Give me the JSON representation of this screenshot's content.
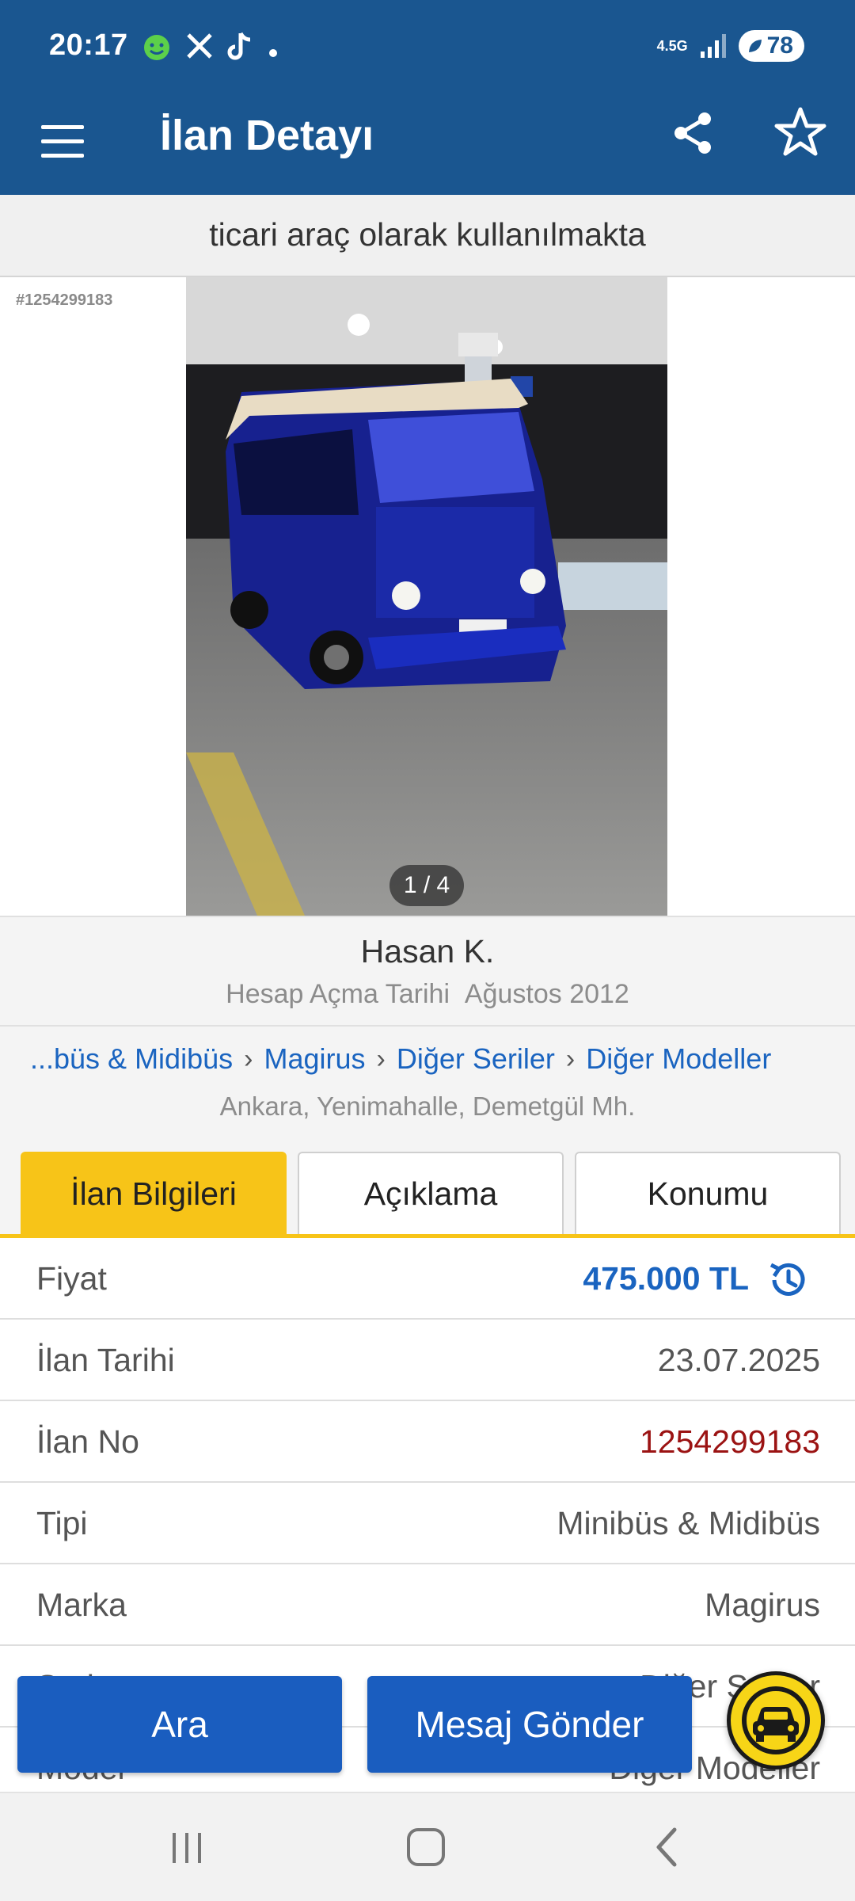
{
  "status_bar": {
    "time": "20:17",
    "network": "4.5G",
    "battery": "78",
    "notification_icons": [
      "happy-face-icon",
      "x-logo-icon",
      "tiktok-icon",
      "dot-icon"
    ]
  },
  "toolbar": {
    "title": "İlan Detayı"
  },
  "subtitle": "ticari araç olarak kullanılmakta",
  "photo": {
    "listing_tag": "#1254299183",
    "counter": "1 / 4"
  },
  "seller": {
    "name": "Hasan K.",
    "since_label": "Hesap Açma Tarihi",
    "since_value": "Ağustos 2012"
  },
  "breadcrumb": {
    "items": [
      "...büs & Midibüs",
      "Magirus",
      "Diğer Seriler",
      "Diğer Modeller"
    ],
    "location": "Ankara, Yenimahalle, Demetgül Mh."
  },
  "tabs": [
    "İlan Bilgileri",
    "Açıklama",
    "Konumu"
  ],
  "info_rows": [
    {
      "label": "Fiyat",
      "value": "475.000 TL"
    },
    {
      "label": "İlan Tarihi",
      "value": "23.07.2025"
    },
    {
      "label": "İlan No",
      "value": "1254299183"
    },
    {
      "label": "Tipi",
      "value": "Minibüs & Midibüs"
    },
    {
      "label": "Marka",
      "value": "Magirus"
    },
    {
      "label": "Seri",
      "value": "Diğer Seriler"
    },
    {
      "label": "Model",
      "value": "Diğer Modeller"
    }
  ],
  "actions": {
    "call": "Ara",
    "message": "Mesaj Gönder"
  },
  "colors": {
    "header": "#1a5690",
    "accent": "#f7c418",
    "link": "#1a64c0",
    "button": "#1a5dbf",
    "listing_no": "#9b1313"
  }
}
